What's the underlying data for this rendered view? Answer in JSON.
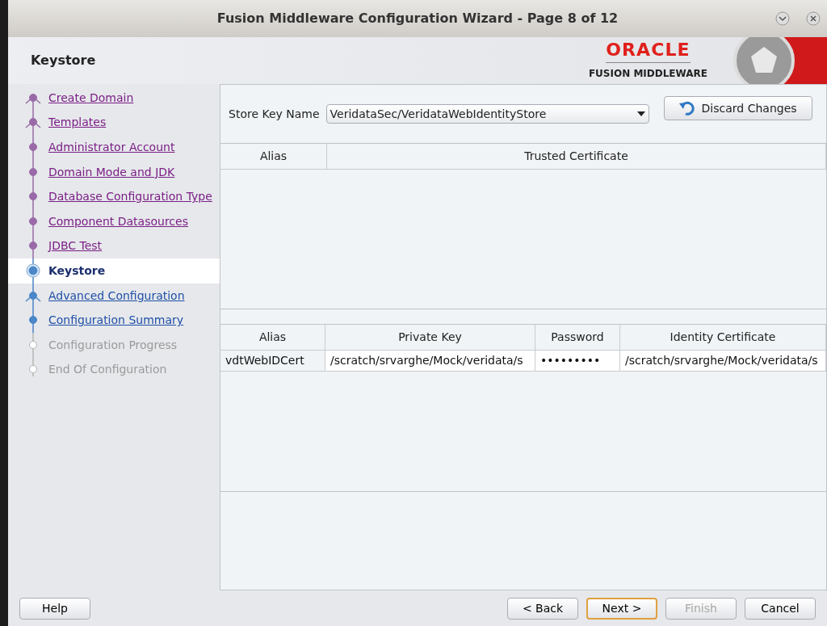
{
  "window": {
    "title": "Fusion Middleware Configuration Wizard - Page 8 of 12"
  },
  "header": {
    "title": "Keystore",
    "logo_top": "ORACLE",
    "logo_bottom": "FUSION MIDDLEWARE"
  },
  "steps": [
    {
      "label": "Create Domain",
      "kind": "visited",
      "branch": true,
      "selected": false
    },
    {
      "label": "Templates",
      "kind": "visited",
      "branch": true,
      "selected": false
    },
    {
      "label": "Administrator Account",
      "kind": "visited",
      "branch": false,
      "selected": false
    },
    {
      "label": "Domain Mode and JDK",
      "kind": "visited",
      "branch": false,
      "selected": false
    },
    {
      "label": "Database Configuration Type",
      "kind": "visited",
      "branch": false,
      "selected": false
    },
    {
      "label": "Component Datasources",
      "kind": "visited",
      "branch": false,
      "selected": false
    },
    {
      "label": "JDBC Test",
      "kind": "visited",
      "branch": false,
      "selected": false
    },
    {
      "label": "Keystore",
      "kind": "current",
      "branch": false,
      "selected": true
    },
    {
      "label": "Advanced Configuration",
      "kind": "pending",
      "branch": true,
      "selected": false
    },
    {
      "label": "Configuration Summary",
      "kind": "pending",
      "branch": false,
      "selected": false
    },
    {
      "label": "Configuration Progress",
      "kind": "disabled",
      "branch": false,
      "selected": false
    },
    {
      "label": "End Of Configuration",
      "kind": "disabled",
      "branch": false,
      "selected": false
    }
  ],
  "store_key": {
    "label": "Store Key Name",
    "value": "VeridataSec/VeridataWebIdentityStore"
  },
  "discard_button": "Discard Changes",
  "trusted_table": {
    "columns": [
      "Alias",
      "Trusted Certificate"
    ]
  },
  "identity_table": {
    "columns": [
      "Alias",
      "Private Key",
      "Password",
      "Identity Certificate"
    ],
    "rows": [
      [
        "vdtWebIDCert",
        "/scratch/srvarghe/Mock/veridata/s",
        "•••••••••",
        "/scratch/srvarghe/Mock/veridata/s"
      ]
    ]
  },
  "buttons": [
    {
      "label": "Help",
      "kind": "left",
      "disabled": false,
      "selected": false
    },
    {
      "label": "< Back",
      "kind": "right",
      "disabled": false,
      "selected": false
    },
    {
      "label": "Next >",
      "kind": "right",
      "disabled": false,
      "selected": true
    },
    {
      "label": "Finish",
      "kind": "right",
      "disabled": true,
      "selected": false
    },
    {
      "label": "Cancel",
      "kind": "right",
      "disabled": false,
      "selected": false
    }
  ]
}
